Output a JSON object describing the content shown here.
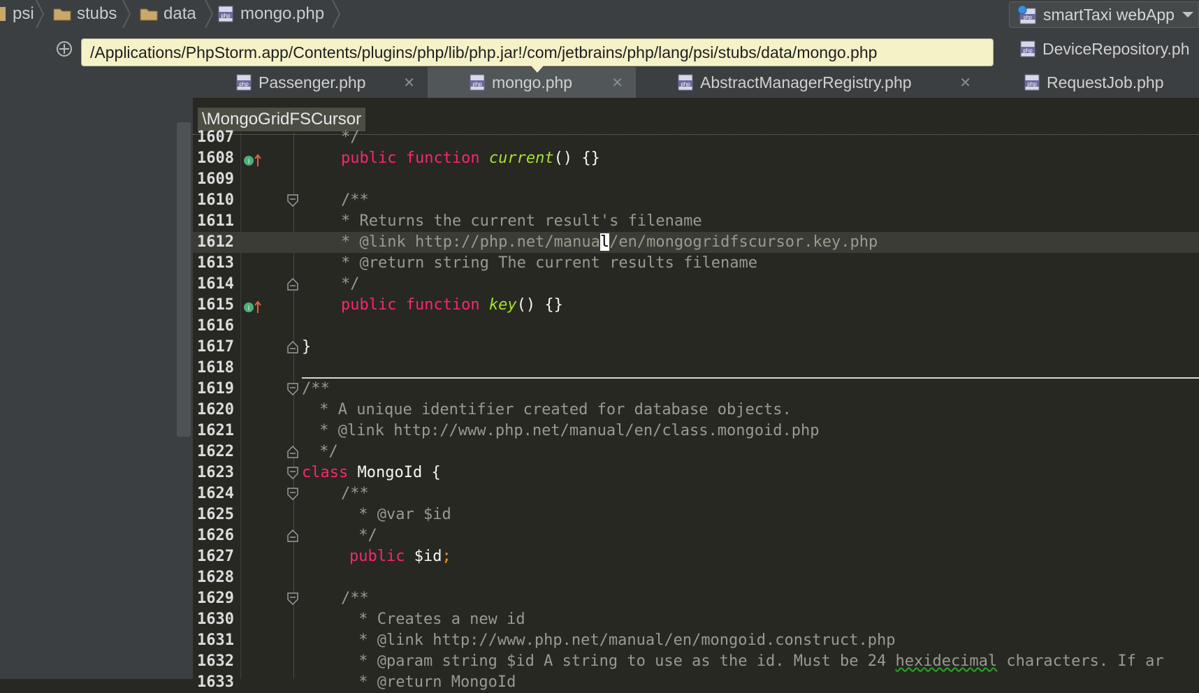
{
  "breadcrumbs": [
    "psi",
    "stubs",
    "data",
    "mongo.php"
  ],
  "run_config": {
    "label": "smartTaxi webApp"
  },
  "tooltip_path": "/Applications/PhpStorm.app/Contents/plugins/php/lib/php.jar!/com/jetbrains/php/lang/psi/stubs/data/mongo.php",
  "tabs": [
    {
      "label": "Passenger.php",
      "active": false
    },
    {
      "label": "mongo.php",
      "active": true
    },
    {
      "label": "AbstractManagerRegistry.php",
      "active": false
    },
    {
      "label": "RequestJob.php",
      "active": false
    }
  ],
  "top_tab": {
    "label": "DeviceRepository.ph"
  },
  "scope_label": "\\MongoGridFSCursor",
  "close_glyph": "✕",
  "code_lines": [
    {
      "n": "1607",
      "t": "*/"
    },
    {
      "n": "1608",
      "kw": "public function ",
      "fn": "current",
      "rest": "() {}"
    },
    {
      "n": "1609",
      "t": ""
    },
    {
      "n": "1610",
      "t": "/**"
    },
    {
      "n": "1611",
      "t": "* Returns the current result's filename"
    },
    {
      "n": "1612",
      "a": "* @link http://php.net/manua",
      "c": "l",
      "b": "/en/mongogridfscursor.key.php"
    },
    {
      "n": "1613",
      "t": "* @return string The current results filename"
    },
    {
      "n": "1614",
      "t": "*/"
    },
    {
      "n": "1615",
      "kw": "public function ",
      "fn": "key",
      "rest": "() {}"
    },
    {
      "n": "1616",
      "t": ""
    },
    {
      "n": "1617",
      "t": "}"
    },
    {
      "n": "1618",
      "t": ""
    },
    {
      "n": "1619",
      "t": "/**"
    },
    {
      "n": "1620",
      "t": " * A unique identifier created for database objects."
    },
    {
      "n": "1621",
      "t": " * @link http://www.php.net/manual/en/class.mongoid.php"
    },
    {
      "n": "1622",
      "t": " */"
    },
    {
      "n": "1623",
      "kw": "class ",
      "name": "MongoId {"
    },
    {
      "n": "1624",
      "t": "/**"
    },
    {
      "n": "1625",
      "t": " * @var $id"
    },
    {
      "n": "1626",
      "t": " */"
    },
    {
      "n": "1627",
      "kw": "public ",
      "var": "$id",
      "semi": ";"
    },
    {
      "n": "1628",
      "t": ""
    },
    {
      "n": "1629",
      "t": "/**"
    },
    {
      "n": "1630",
      "t": " * Creates a new id"
    },
    {
      "n": "1631",
      "t": " * @link http://www.php.net/manual/en/mongoid.construct.php"
    },
    {
      "n": "1632",
      "a": " * @param string $id A string to use as the id. Must be 24 ",
      "sq": "hexidecimal",
      "b": " characters. If ar"
    },
    {
      "n": "1633",
      "t": " * @return MongoId"
    }
  ]
}
